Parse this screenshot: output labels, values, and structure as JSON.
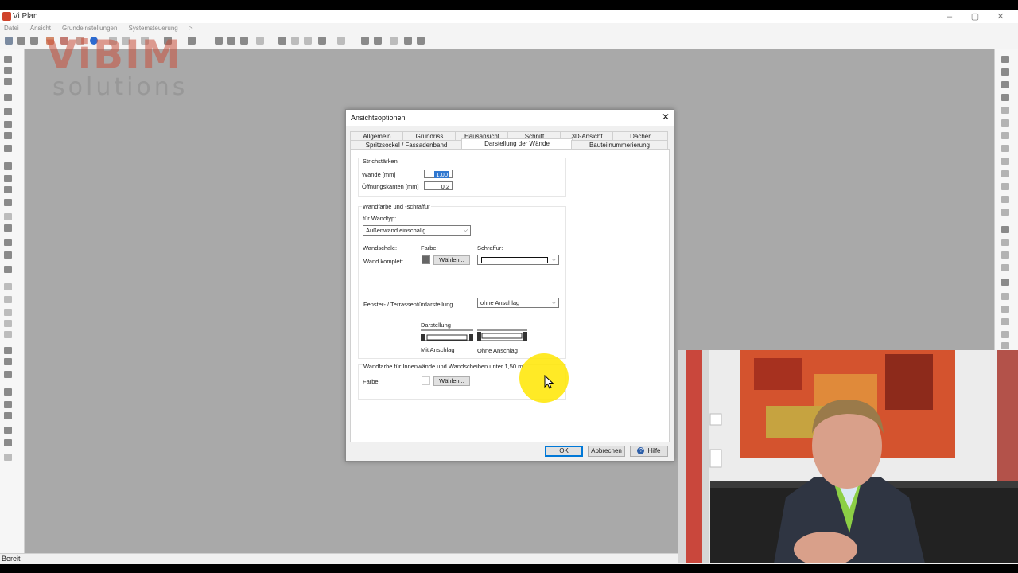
{
  "app": {
    "title": "Vi Plan",
    "menu": [
      "Datei",
      "Ansicht",
      "Grundeinstellungen",
      "Systemsteuerung",
      ">"
    ],
    "window_controls": [
      "–",
      "▢",
      "✕"
    ],
    "status": "Bereit",
    "logo_text": "ViBIM",
    "logo_sub": "solutions"
  },
  "dialog": {
    "title": "Ansichtsoptionen",
    "close": "✕",
    "tabs_row1": [
      "Allgemein",
      "Grundriss",
      "Hausansicht",
      "Schnitt",
      "3D-Ansicht",
      "Dächer"
    ],
    "tabs_row2": [
      "Spritzsockel / Fassadenband",
      "Darstellung der Wände",
      "Bauteilnummerierung"
    ],
    "active_tab": "Darstellung der Wände",
    "strichstaerken": {
      "heading": "Strichstärken",
      "waende_label": "Wände [mm]",
      "waende_value": "1.00",
      "oeffnung_label": "Öffnungskanten [mm]",
      "oeffnung_value": "0.2"
    },
    "wandfarbe": {
      "heading": "Wandfarbe und -schraffur",
      "wandtyp_label": "für Wandtyp:",
      "wandtyp_value": "Außenwand einschalig",
      "wandschale_label": "Wandschale:",
      "farbe_label": "Farbe:",
      "schraffur_label": "Schraffur:",
      "wand_komplett_label": "Wand komplett",
      "waehlen_label": "Wählen...",
      "swatch_color": "#666666",
      "fenster_label": "Fenster- / Terrassentürdarstellung",
      "fenster_value": "ohne Anschlag",
      "darstellung_label": "Darstellung",
      "mit_anschlag": "Mit Anschlag",
      "ohne_anschlag": "Ohne Anschlag"
    },
    "innenwand": {
      "heading": "Wandfarbe für Innenwände und Wandscheiben unter 1,50 m",
      "farbe_label": "Farbe:",
      "waehlen_label": "Wählen...",
      "swatch_color": "#ffffff"
    },
    "buttons": {
      "ok": "OK",
      "cancel": "Abbrechen",
      "help": "Hilfe",
      "help_icon": "?"
    }
  }
}
